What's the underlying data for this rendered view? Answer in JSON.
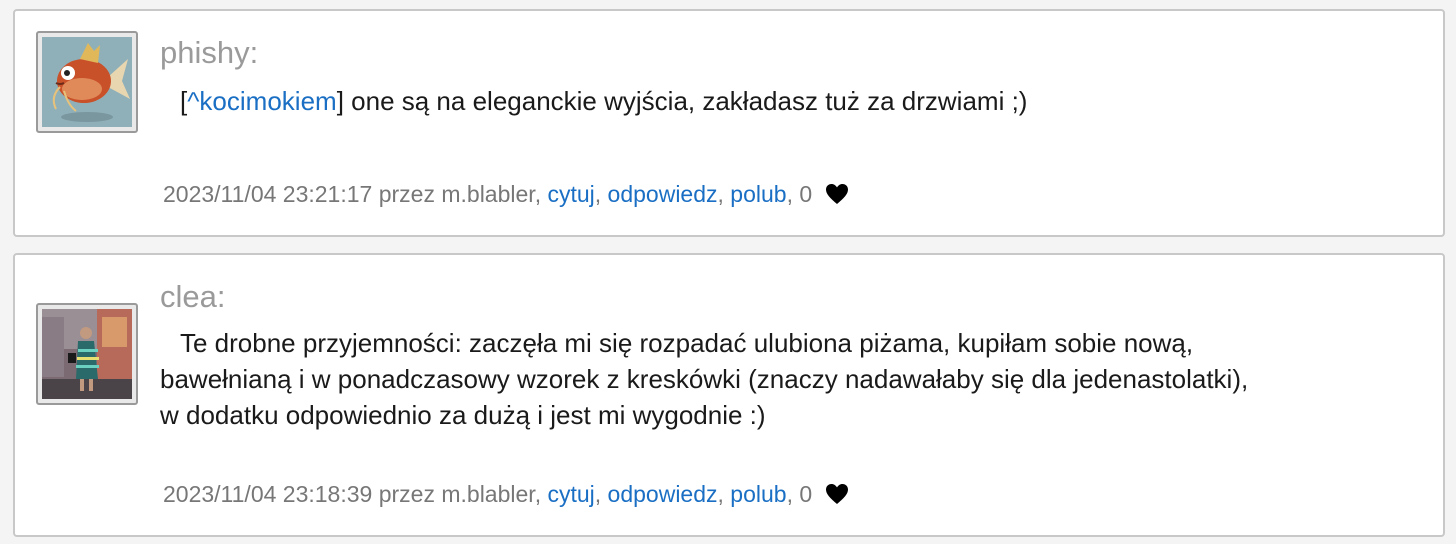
{
  "posts": [
    {
      "author": "phishy:",
      "mention_open": "[",
      "mention": "^kocimokiem",
      "mention_close": "]",
      "text": " one są na eleganckie wyjścia, zakładasz tuż za drzwiami ;)",
      "meta": {
        "timestamp": "2023/11/04 23:21:17",
        "via": "przez m.blabler",
        "quote_label": "cytuj",
        "reply_label": "odpowiedz",
        "like_label": "polub",
        "like_count": "0"
      },
      "avatar_icon": "fish-avatar-icon"
    },
    {
      "author": "clea:",
      "text_lines": [
        "Te drobne przyjemności: zaczęła mi się rozpadać ulubiona piżama, kupiłam sobie nową,",
        "bawełnianą i w ponadczasowy wzorek z kreskówki (znaczy nadawałaby się dla jedenastolatki),",
        "w dodatku odpowiednio za dużą i jest mi wygodnie :)"
      ],
      "meta": {
        "timestamp": "2023/11/04 23:18:39",
        "via": "przez m.blabler",
        "quote_label": "cytuj",
        "reply_label": "odpowiedz",
        "like_label": "polub",
        "like_count": "0"
      },
      "avatar_icon": "person-photo-avatar-icon"
    }
  ],
  "colors": {
    "link": "#1a6fc4",
    "author": "#9a9a9a",
    "meta": "#777777",
    "text": "#1a1a1a",
    "border": "#c8c8c8",
    "background": "#f4f4f4"
  },
  "separator": ", ",
  "heart_icon": "heart-icon"
}
